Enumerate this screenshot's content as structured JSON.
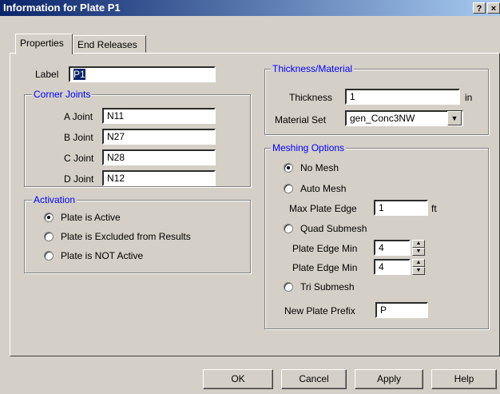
{
  "window": {
    "title": "Information for Plate P1",
    "help_btn": "?",
    "close_btn": "×"
  },
  "tabs": [
    {
      "label": "Properties"
    },
    {
      "label": "End Releases"
    }
  ],
  "label_field": {
    "label": "Label",
    "value": "P1"
  },
  "corner_joints": {
    "legend": "Corner Joints",
    "rows": [
      {
        "label": "A Joint",
        "value": "N11"
      },
      {
        "label": "B Joint",
        "value": "N27"
      },
      {
        "label": "C Joint",
        "value": "N28"
      },
      {
        "label": "D Joint",
        "value": "N12"
      }
    ]
  },
  "activation": {
    "legend": "Activation",
    "options": [
      {
        "label": "Plate is Active",
        "selected": true
      },
      {
        "label": "Plate is Excluded from Results",
        "selected": false
      },
      {
        "label": "Plate is NOT Active",
        "selected": false
      }
    ]
  },
  "thickness_material": {
    "legend": "Thickness/Material",
    "thickness_label": "Thickness",
    "thickness_value": "1",
    "thickness_unit": "in",
    "material_label": "Material Set",
    "material_value": "gen_Conc3NW"
  },
  "meshing": {
    "legend": "Meshing Options",
    "no_mesh": "No Mesh",
    "auto_mesh": "Auto Mesh",
    "max_plate_edge_label": "Max Plate Edge",
    "max_plate_edge_value": "1",
    "max_plate_edge_unit": "ft",
    "quad_submesh": "Quad Submesh",
    "edge_min_1_label": "Plate Edge Min",
    "edge_min_1_value": "4",
    "edge_min_2_label": "Plate Edge Min",
    "edge_min_2_value": "4",
    "tri_submesh": "Tri Submesh",
    "prefix_label": "New Plate Prefix",
    "prefix_value": "P",
    "selected": "no_mesh"
  },
  "buttons": {
    "ok": "OK",
    "cancel": "Cancel",
    "apply": "Apply",
    "help": "Help"
  }
}
